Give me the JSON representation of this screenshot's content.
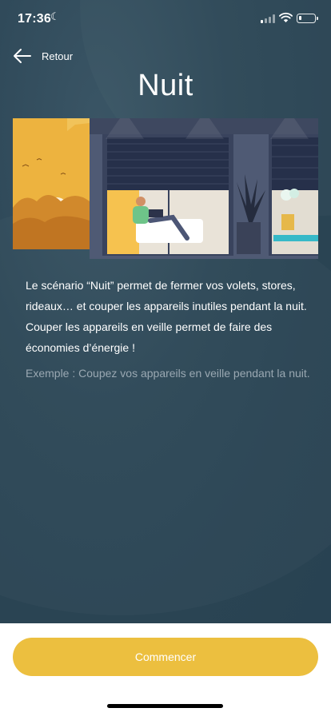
{
  "status_bar": {
    "time": "17:36",
    "focus_icon": "moon-icon",
    "signal_icon": "cellular-signal-icon",
    "wifi_icon": "wifi-icon",
    "battery_icon": "battery-icon",
    "battery_level": 0.1
  },
  "header": {
    "back_label": "Retour",
    "back_icon": "arrow-left-icon",
    "title": "Nuit"
  },
  "content": {
    "description": "Le scénario “Nuit” permet de fermer vos volets, stores, rideaux… et couper les appareils inutiles pendant la nuit. Couper les appareils en veille permet de faire des économies d’énergie !",
    "example": "Exemple : Coupez vos appareils en veille pendant la nuit."
  },
  "footer": {
    "start_label": "Commencer"
  },
  "colors": {
    "background": "#2e4858",
    "accent": "#ecbf3f",
    "text": "#ffffff",
    "muted_text": "#9aa8b2"
  }
}
